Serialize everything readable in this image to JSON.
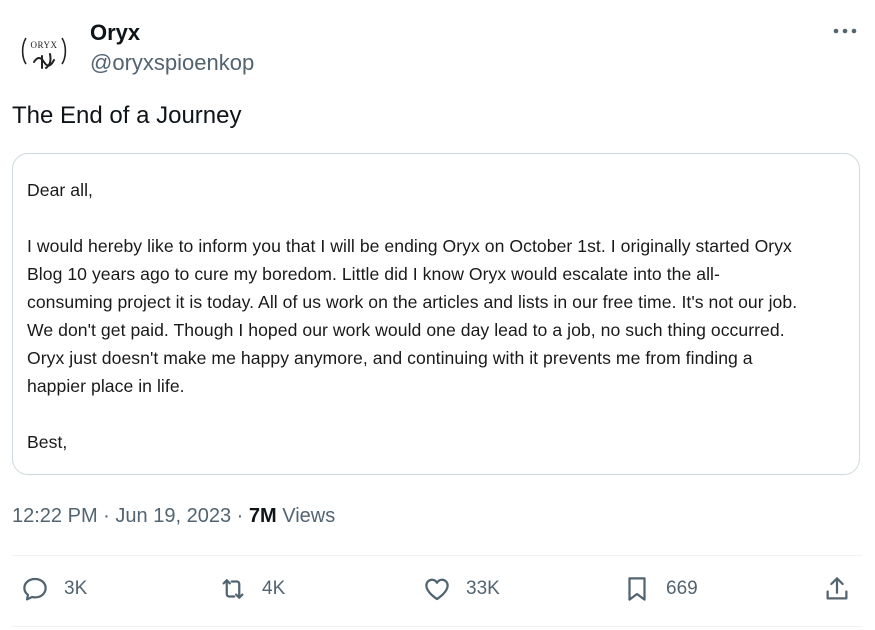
{
  "author": {
    "display_name": "Oryx",
    "handle": "@oryxspioenkop",
    "avatar_text": "ORYX"
  },
  "tweet": {
    "text": "The End of a Journey"
  },
  "letter": {
    "greeting": "Dear all,",
    "body_lines": [
      "I would hereby like to inform you that I will be ending Oryx on October 1st. I originally started Oryx",
      "Blog 10 years ago to cure my boredom. Little did I know Oryx would escalate into the all-",
      "consuming project it is today. All of us work on the articles and lists in our free time. It's not our job.",
      "We don't get paid. Though I hoped our work would one day lead to a job, no such thing occurred.",
      "Oryx just doesn't make me happy anymore, and continuing with it prevents me from finding a",
      "happier place in life."
    ],
    "closing": "Best,"
  },
  "meta": {
    "time": "12:22 PM",
    "separator": "·",
    "date": "Jun 19, 2023",
    "views_count": "7M",
    "views_label": "Views"
  },
  "actions": {
    "replies": "3K",
    "reposts": "4K",
    "likes": "33K",
    "bookmarks": "669"
  },
  "icons": {
    "more": "more-horizontal-icon",
    "reply": "reply-icon",
    "repost": "repost-icon",
    "like": "heart-icon",
    "bookmark": "bookmark-icon",
    "share": "share-icon"
  },
  "colors": {
    "text_primary": "#0f1419",
    "text_secondary": "#536471",
    "border": "#cfd9de"
  }
}
